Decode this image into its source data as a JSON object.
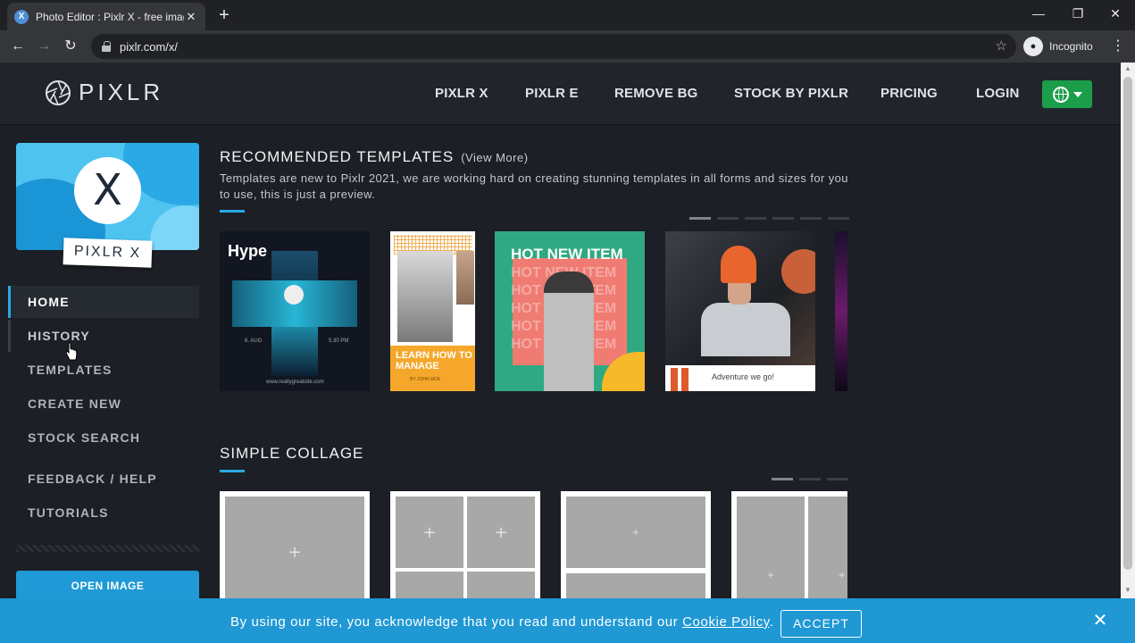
{
  "browser": {
    "tab_title": "Photo Editor : Pixlr X - free image",
    "url": "pixlr.com/x/",
    "incognito_label": "Incognito"
  },
  "header": {
    "logo_text": "PIXLR",
    "nav": [
      "PIXLR X",
      "PIXLR E",
      "REMOVE BG",
      "STOCK BY PIXLR",
      "PRICING",
      "LOGIN"
    ],
    "lang_button_color": "#1b9e4a"
  },
  "sidebar": {
    "app_card_letter": "X",
    "app_card_label": "PIXLR X",
    "items": [
      "HOME",
      "HISTORY",
      "TEMPLATES",
      "CREATE NEW",
      "STOCK SEARCH",
      "FEEDBACK / HELP",
      "TUTORIALS"
    ],
    "active_item": "HOME",
    "open_image_label": "OPEN IMAGE"
  },
  "recommended": {
    "title": "RECOMMENDED TEMPLATES",
    "view_more": "(View More)",
    "description": "Templates are new to Pixlr 2021, we are working hard on creating stunning templates in all forms and sizes for you to use, this is just a preview.",
    "templates": [
      {
        "name": "hype",
        "title": "Hype",
        "date": "6. AUG",
        "time": "5.30 PM",
        "site": "www.reallygreatsite.com"
      },
      {
        "name": "learn-how-to-manage",
        "title": "LEARN HOW TO MANAGE",
        "byline": "BY JOHN MOE"
      },
      {
        "name": "hot-new-item",
        "title": "HOT NEW ITEM"
      },
      {
        "name": "adventure",
        "caption": "Adventure we go!"
      }
    ],
    "page_count": 6,
    "active_page": 1
  },
  "collage": {
    "title": "SIMPLE COLLAGE",
    "plus": "+",
    "page_count": 3,
    "active_page": 1
  },
  "cookie": {
    "text": "By using our site, you acknowledge that you read and understand our",
    "link": "Cookie Policy",
    "period": ".",
    "accept": "ACCEPT",
    "close": "✕"
  },
  "colors": {
    "accent": "#2aa9e6",
    "cookie_bar": "#1f98d4",
    "background": "#1c1f25"
  }
}
